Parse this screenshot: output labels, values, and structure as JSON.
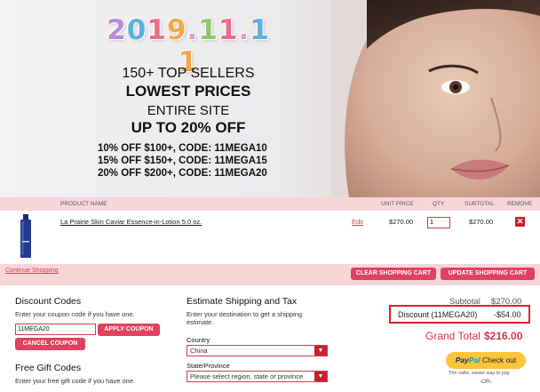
{
  "banner": {
    "date": "2019.11.11",
    "line1": "150+ TOP SELLERS",
    "line2": "LOWEST PRICES",
    "line3": "ENTIRE SITE",
    "line4": "UP TO 20% OFF",
    "codes": [
      "10% OFF $100+, CODE: 11MEGA10",
      "15% OFF $150+, CODE: 11MEGA15",
      "20% OFF $200+, CODE: 11MEGA20"
    ],
    "date_colors": [
      "#b98ad8",
      "#5fb0d9",
      "#e86d8a",
      "#f0a94b",
      "#8fc66b",
      "#e86d8a",
      "#5fb0d9",
      "#f0a94b",
      "#b98ad8",
      "#e86d8a"
    ]
  },
  "cart": {
    "headers": {
      "product_name": "PRODUCT NAME",
      "unit_price": "UNIT PRICE",
      "qty": "QTY",
      "subtotal": "SUBTOTAL",
      "remove": "REMOVE"
    },
    "items": [
      {
        "name": "La Prairie Skin Caviar Essence-in-Lotion 5.0 oz.",
        "edit": "Edit",
        "unit_price": "$270.00",
        "qty": "1",
        "subtotal": "$270.00",
        "remove_icon": "close-icon"
      }
    ],
    "continue_link": "Continue Shopping",
    "clear_button": "CLEAR SHOPPING CART",
    "update_button": "UPDATE SHOPPING CART"
  },
  "discount": {
    "title": "Discount Codes",
    "help": "Enter your coupon code if you have one.",
    "code_value": "11MEGA20",
    "apply_button": "APPLY COUPON",
    "cancel_button": "CANCEL COUPON"
  },
  "gift": {
    "title": "Free Gift Codes",
    "help": "Enter your free gift code if you have one."
  },
  "shipping": {
    "title": "Estimate Shipping and Tax",
    "help": "Enter your destination to get a shipping estimate.",
    "country_label": "Country",
    "country_value": "China",
    "state_label": "State/Province",
    "state_placeholder": "Please select region, state or province"
  },
  "totals": {
    "subtotal_label": "Subtotal",
    "subtotal_value": "$270.00",
    "discount_label": "Discount (11MEGA20)",
    "discount_value": "-$54.00",
    "grand_label": "Grand Total",
    "grand_value": "$216.00",
    "paypal_brand1": "Pay",
    "paypal_brand2": "Pal",
    "paypal_checkout": "Check out",
    "paypal_tagline": "The safer, easier way to pay",
    "or_text": "-OR-"
  },
  "colors": {
    "accent": "#e0415e",
    "pink_band": "#f7d5d9",
    "highlight_border": "#e0202a"
  }
}
